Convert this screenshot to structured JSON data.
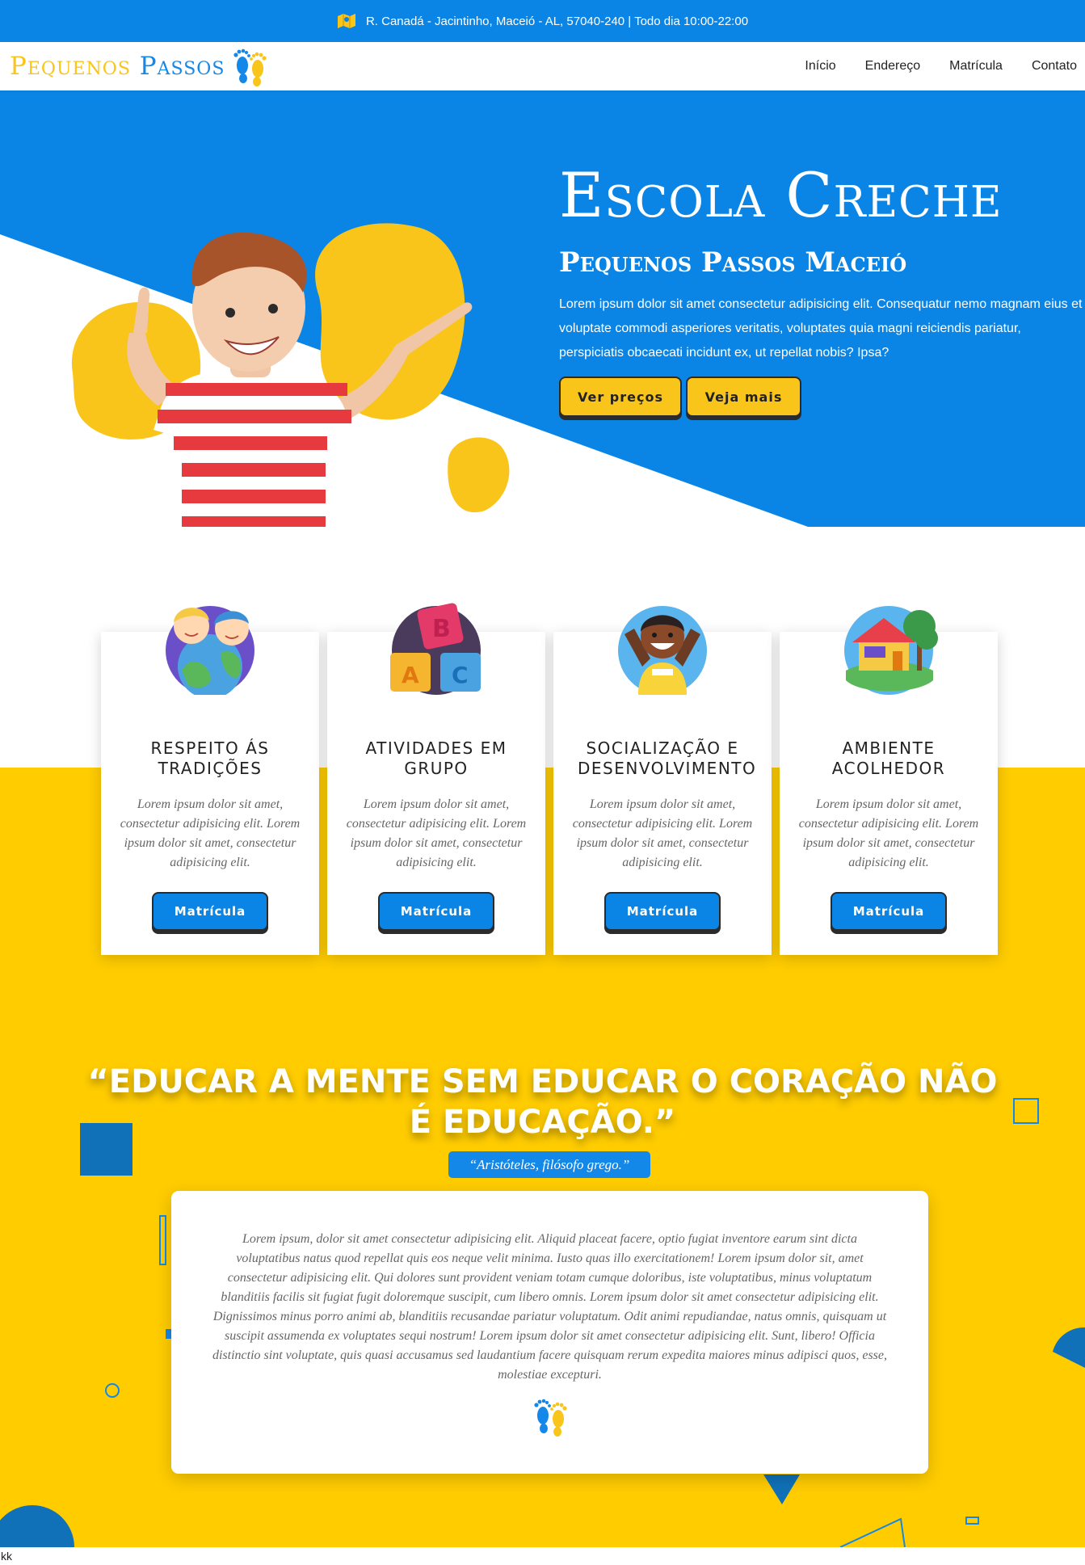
{
  "topbar": {
    "address": "R. Canadá - Jacintinho, Maceió - AL, 57040-240 | Todo dia 10:00-22:00",
    "icon": "map-icon"
  },
  "brand": {
    "word1": "Pequenos",
    "word2": "Passos",
    "icon": "feet-icon"
  },
  "nav": {
    "items": [
      "Início",
      "Endereço",
      "Matrícula",
      "Contato"
    ]
  },
  "hero": {
    "title": "Escola Creche",
    "subtitle": "Pequenos Passos Maceió",
    "text": "Lorem ipsum dolor sit amet consectetur adipisicing elit. Consequatur nemo magnam eius et voluptate commodi asperiores veritatis, voluptates quia magni reiciendis pariatur, perspiciatis obcaecati incidunt ex, ut repellat nobis? Ipsa?",
    "btn_prices": "Ver preços",
    "btn_more": "Veja mais"
  },
  "cards": [
    {
      "title": "RESPEITO ÁS TRADIÇÕES",
      "text": "Lorem ipsum dolor sit amet, consectetur adipisicing elit. Lorem ipsum dolor sit amet, consectetur adipisicing elit.",
      "button": "Matrícula",
      "icon": "kids-globe-icon"
    },
    {
      "title": "ATIVIDADES EM GRUPO",
      "text": "Lorem ipsum dolor sit amet, consectetur adipisicing elit. Lorem ipsum dolor sit amet, consectetur adipisicing elit.",
      "button": "Matrícula",
      "icon": "abc-blocks-icon"
    },
    {
      "title": "SOCIALIZAÇÃO E DESENVOLVIMENTO",
      "text": "Lorem ipsum dolor sit amet, consectetur adipisicing elit. Lorem ipsum dolor sit amet, consectetur adipisicing elit.",
      "button": "Matrícula",
      "icon": "happy-child-icon"
    },
    {
      "title": "AMBIENTE ACOLHEDOR",
      "text": "Lorem ipsum dolor sit amet, consectetur adipisicing elit. Lorem ipsum dolor sit amet, consectetur adipisicing elit.",
      "button": "Matrícula",
      "icon": "house-icon"
    }
  ],
  "quote": {
    "text": "“EDUCAR A MENTE SEM EDUCAR O CORAÇÃO NÃO É EDUCAÇÃO.”",
    "author": "“Aristóteles, filósofo grego.”",
    "body": "Lorem ipsum, dolor sit amet consectetur adipisicing elit. Aliquid placeat facere, optio fugiat inventore earum sint dicta voluptatibus natus quod repellat quis eos neque velit minima. Iusto quas illo exercitationem! Lorem ipsum dolor sit, amet consectetur adipisicing elit. Qui dolores sunt provident veniam totam cumque doloribus, iste voluptatibus, minus voluptatum blanditiis facilis sit fugiat fugit doloremque suscipit, cum libero omnis. Lorem ipsum dolor sit amet consectetur adipisicing elit. Dignissimos minus porro animi ab, blanditiis recusandae pariatur voluptatum. Odit animi repudiandae, natus omnis, quisquam ut suscipit assumenda ex voluptates sequi nostrum! Lorem ipsum dolor sit amet consectetur adipisicing elit. Sunt, libero! Officia distinctio sint voluptate, quis quasi accusamus sed laudantium facere quisquam rerum expedita maiores minus adipisci quos, esse, molestiae excepturi."
  },
  "footer": {
    "text": "kk"
  },
  "colors": {
    "blue": "#0a85e6",
    "yellow": "#ffcc00",
    "button_yellow": "#f9c51a",
    "dark_border": "#2b2b2b"
  }
}
